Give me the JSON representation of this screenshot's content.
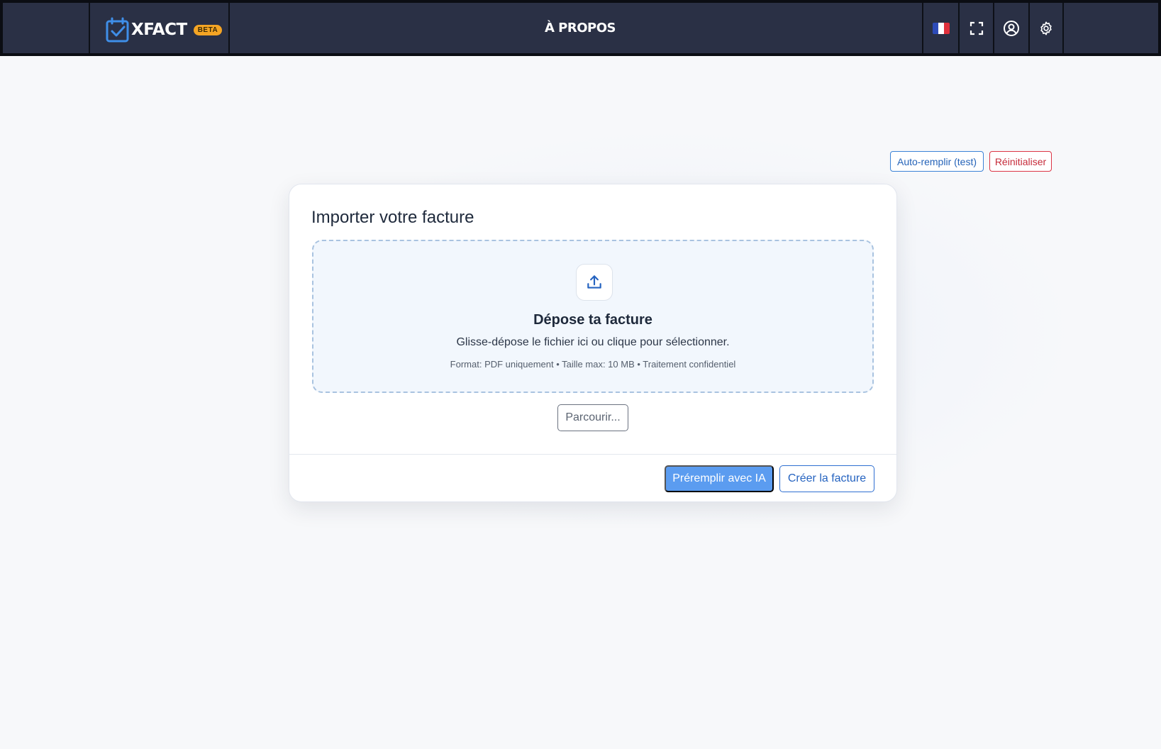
{
  "app": {
    "brand": "XFACT",
    "badge": "BETA",
    "nav_title": "À PROPOS"
  },
  "nav_icons": [
    "flag-fr-icon",
    "fullscreen-icon",
    "user-circle-icon",
    "gear-icon"
  ],
  "toolbar": {
    "autofill_label": "Auto-remplir (test)",
    "reset_label": "Réinitialiser"
  },
  "card": {
    "title": "Importer votre facture",
    "dropzone": {
      "icon": "upload-icon",
      "title": "Dépose ta facture",
      "subtitle": "Glisse-dépose le fichier ici ou clique pour sélectionner.",
      "meta": "Format: PDF uniquement • Taille max: 10 MB • Traitement confidentiel"
    },
    "browse_label": "Parcourir...",
    "ai_label": "Préremplir avec IA",
    "create_label": "Créer la facture"
  },
  "colors": {
    "nav_bg": "#2a3045",
    "accent": "#2563c0",
    "primary_button": "#5b9cf0",
    "danger": "#c62b3a",
    "badge": "#f5a524",
    "dropzone_bg": "#f2f7fd"
  }
}
